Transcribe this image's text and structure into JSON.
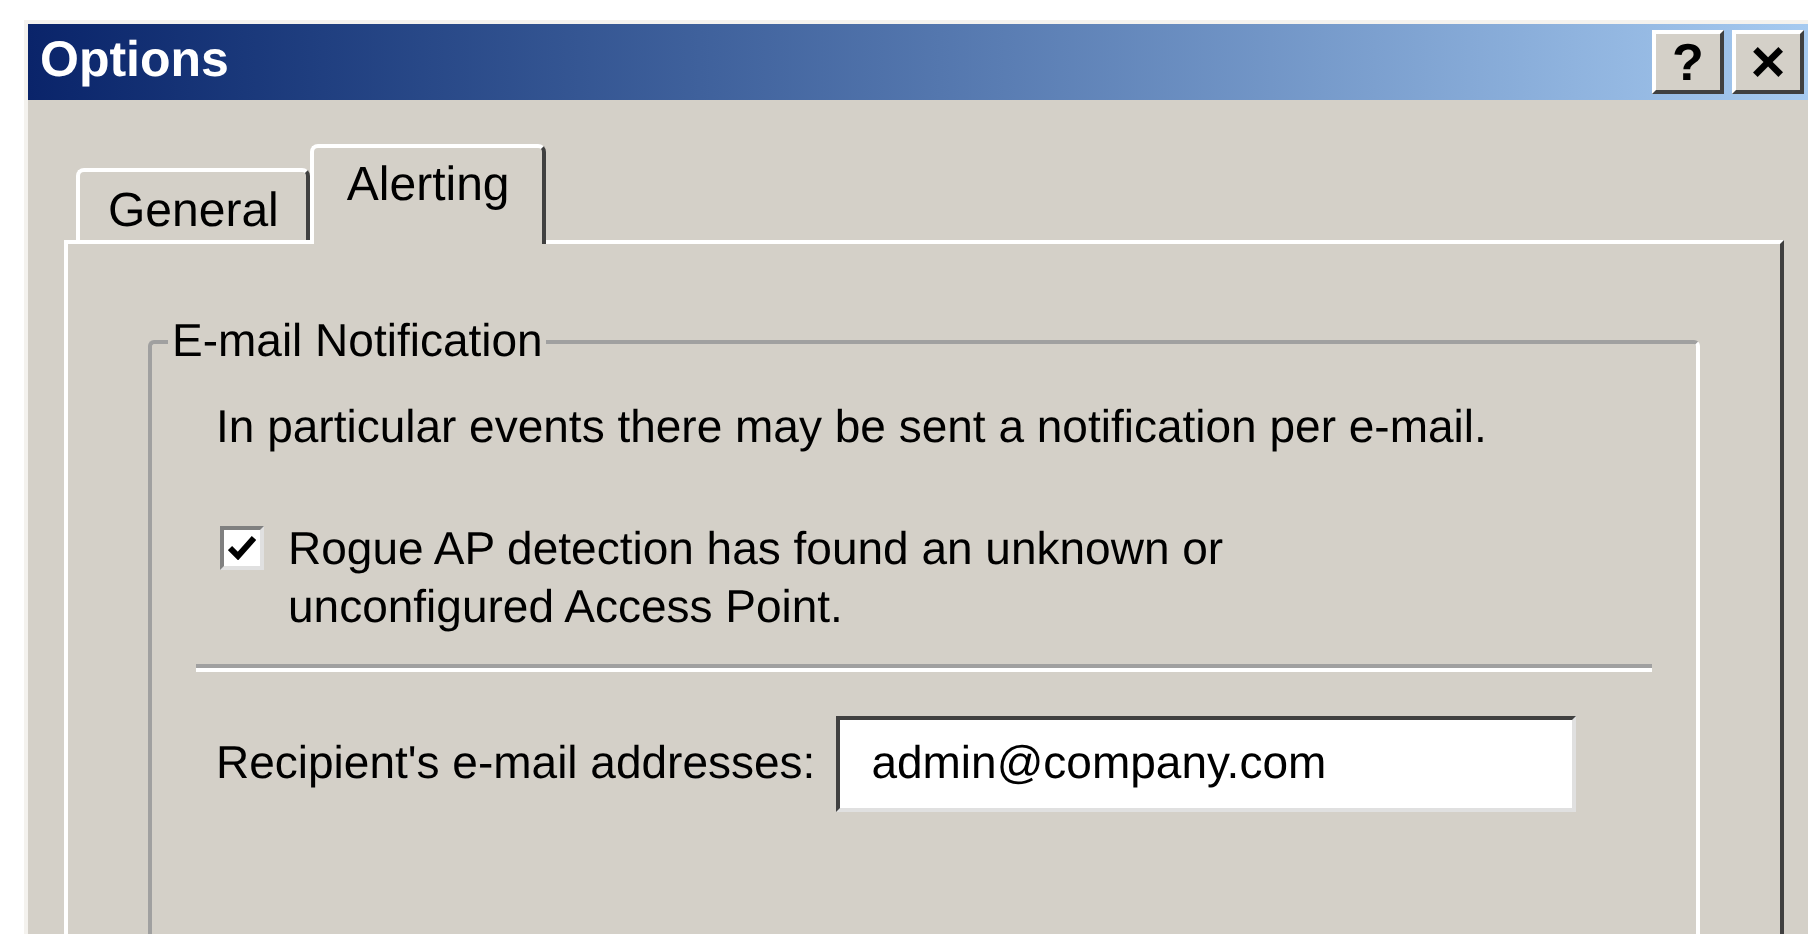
{
  "window": {
    "title": "Options",
    "buttons": [
      {
        "kind": "help",
        "label": "?"
      },
      {
        "kind": "close",
        "label": "×"
      }
    ]
  },
  "tabs": [
    {
      "label": "General",
      "selected": false
    },
    {
      "label": "Alerting",
      "selected": true
    }
  ],
  "group": {
    "title": "E-mail Notification",
    "description": "In particular events there may be sent a notification per e-mail.",
    "checkbox": {
      "label": "Rogue AP detection has found an unknown or unconfigured Access Point.",
      "checked": true
    },
    "recipients": {
      "label": "Recipient's e-mail addresses:",
      "value": "admin@company.com"
    }
  }
}
